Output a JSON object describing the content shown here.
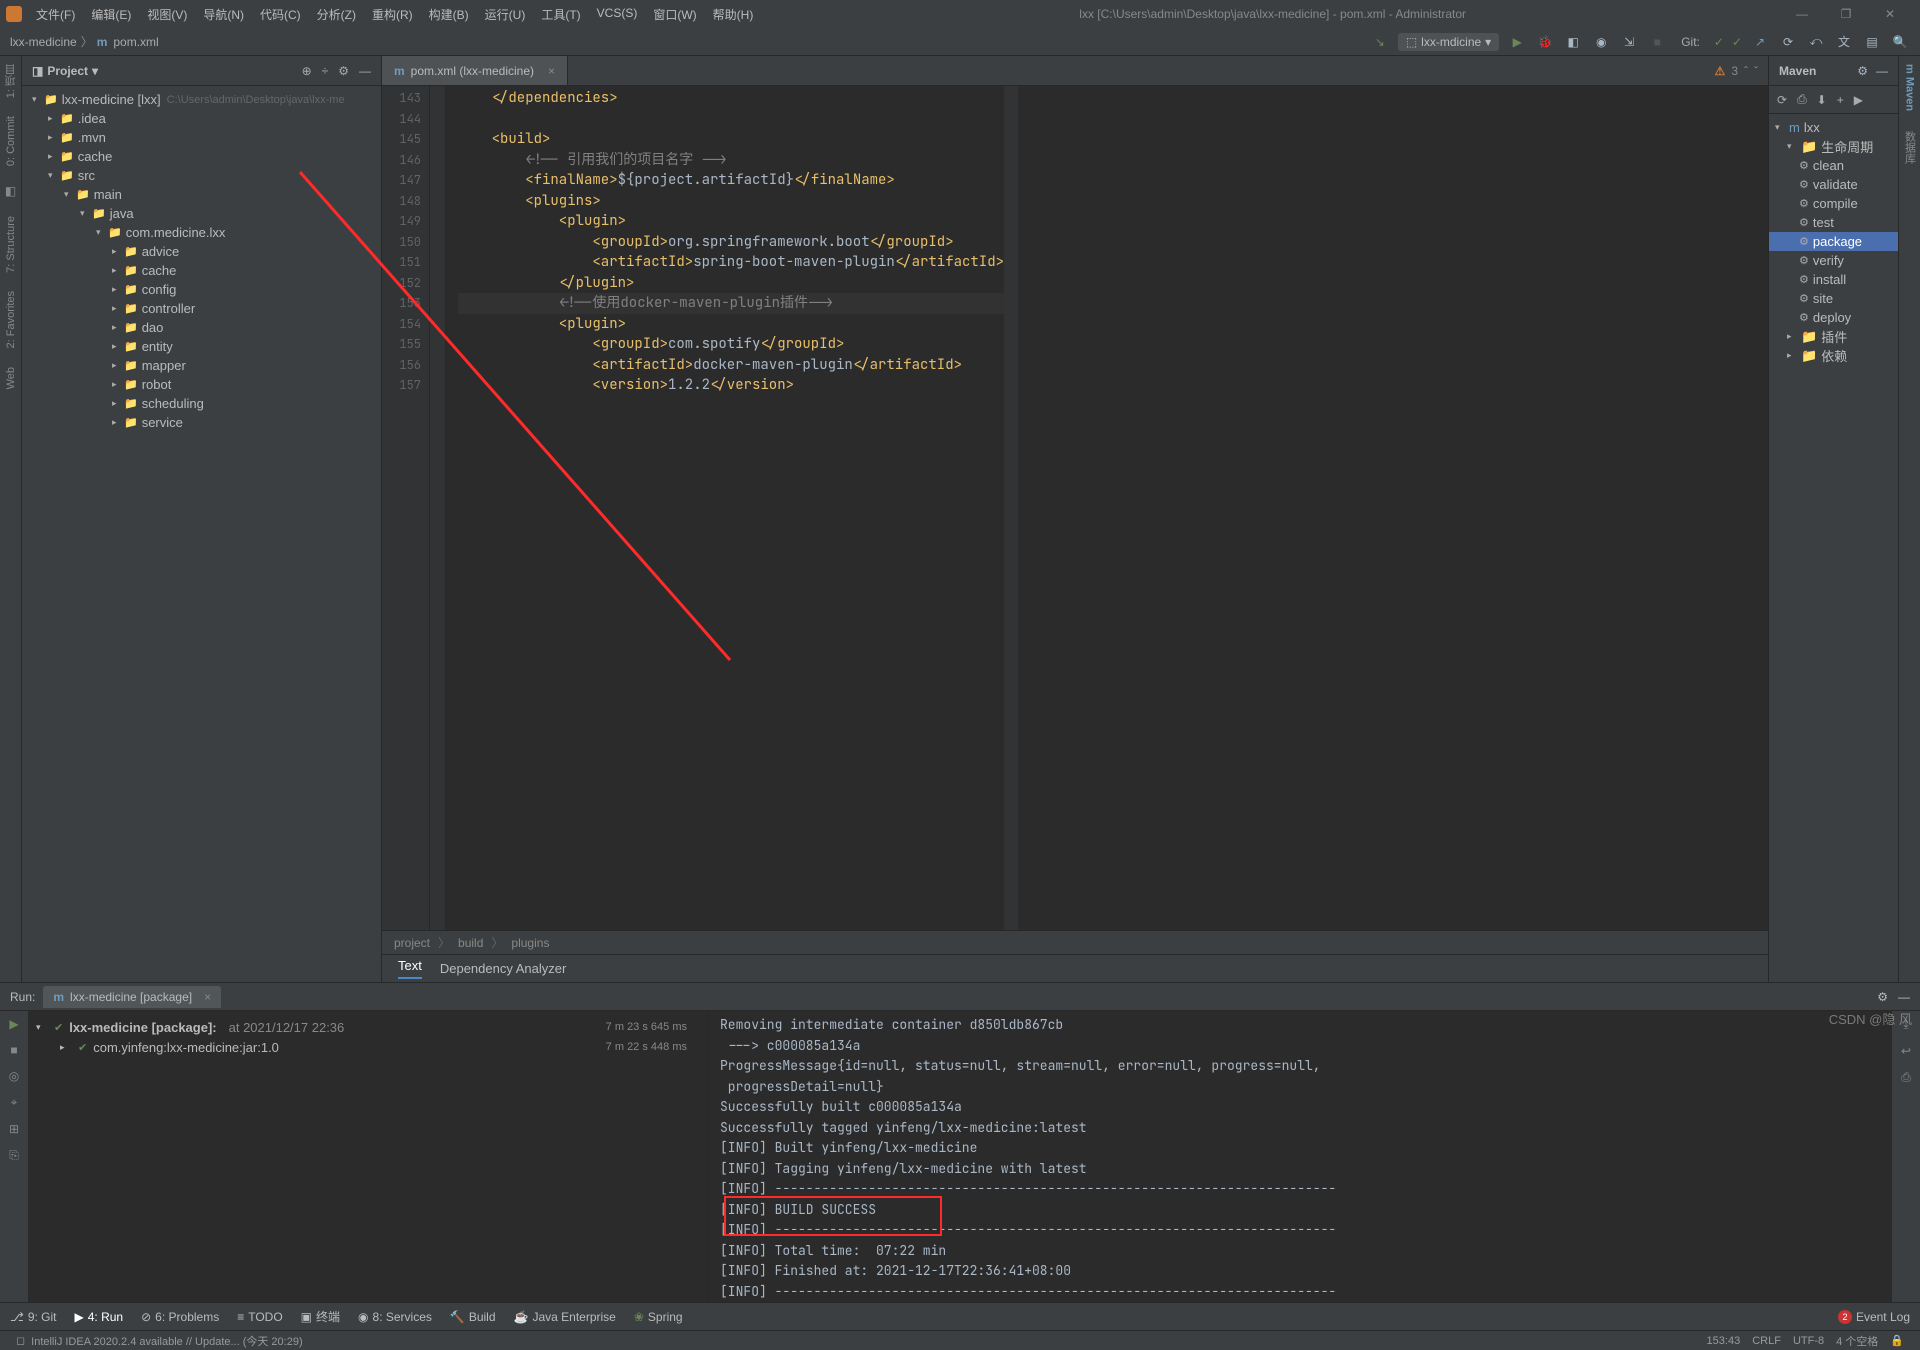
{
  "titlebar": {
    "menus": [
      "文件(F)",
      "编辑(E)",
      "视图(V)",
      "导航(N)",
      "代码(C)",
      "分析(Z)",
      "重构(R)",
      "构建(B)",
      "运行(U)",
      "工具(T)",
      "VCS(S)",
      "窗口(W)",
      "帮助(H)"
    ],
    "title": "lxx [C:\\Users\\admin\\Desktop\\java\\lxx-medicine] - pom.xml - Administrator"
  },
  "breadcrumb": {
    "items": [
      "lxx-medicine",
      "pom.xml"
    ]
  },
  "toolbar": {
    "run_config": "lxx-mdicine",
    "git_label": "Git:"
  },
  "left_tool_tabs": [
    "项目",
    "Commit",
    "Structure",
    "Favorites",
    "Web"
  ],
  "project": {
    "title": "Project",
    "root": {
      "name": "lxx-medicine [lxx]",
      "path": "C:\\Users\\admin\\Desktop\\java\\lxx-me"
    },
    "items": [
      ".idea",
      ".mvn",
      "cache",
      "src"
    ],
    "main": "main",
    "java": "java",
    "pkg": "com.medicine.lxx",
    "subpkgs": [
      "advice",
      "cache",
      "config",
      "controller",
      "dao",
      "entity",
      "mapper",
      "robot",
      "scheduling",
      "service"
    ]
  },
  "editor": {
    "tab": "pom.xml (lxx-medicine)",
    "inspection": {
      "warn_count": "3"
    },
    "lines": {
      "143": "</dependencies>",
      "144": "",
      "145": "<build>",
      "145b": "<!-- 引用我们的项目名字 -->",
      "147": "<finalName>${project.artifactId}</finalName>",
      "148": "<plugins>",
      "149": "<plugin>",
      "150": "<groupId>org.springframework.boot</groupId>",
      "151": "<artifactId>spring-boot-maven-plugin</artifactId>",
      "152": "</plugin>",
      "153": "<!--使用docker-maven-plugin插件-->",
      "154": "<plugin>",
      "155": "<groupId>com.spotify</groupId>",
      "156": "<artifactId>docker-maven-plugin</artifactId>",
      "157": "<version>1.2.2</version>"
    },
    "crumbs": [
      "project",
      "build",
      "plugins"
    ],
    "subtabs": [
      "Text",
      "Dependency Analyzer"
    ]
  },
  "maven": {
    "title": "Maven",
    "root": "lxx",
    "lifecycle": "生命周期",
    "phases": [
      "clean",
      "validate",
      "compile",
      "test",
      "package",
      "verify",
      "install",
      "site",
      "deploy"
    ],
    "plugins_label": "插件",
    "deps_label": "依赖"
  },
  "run": {
    "label": "Run:",
    "tab": "lxx-medicine [package]",
    "tree_root": {
      "name": "lxx-medicine [package]:",
      "ts": "at 2021/12/17 22:36",
      "elapsed": "7 m 23 s 645 ms"
    },
    "tree_child": {
      "name": "com.yinfeng:lxx-medicine:jar:1.0",
      "elapsed": "7 m 22 s 448 ms"
    },
    "console": [
      "Removing intermediate container d850ldb867cb",
      " ---> c000085a134a",
      "ProgressMessage{id=null, status=null, stream=null, error=null, progress=null,",
      " progressDetail=null}",
      "Successfully built c000085a134a",
      "Successfully tagged yinfeng/lxx-medicine:latest",
      "[INFO] Built yinfeng/lxx-medicine",
      "[INFO] Tagging yinfeng/lxx-medicine with latest",
      "[INFO] ------------------------------------------------------------------------",
      "[INFO] BUILD SUCCESS",
      "[INFO] ------------------------------------------------------------------------",
      "[INFO] Total time:  07:22 min",
      "[INFO] Finished at: 2021-12-17T22:36:41+08:00",
      "[INFO] ------------------------------------------------------------------------"
    ]
  },
  "bottombar": {
    "items": [
      "9: Git",
      "4: Run",
      "6: Problems",
      "TODO",
      "终端",
      "8: Services",
      "Build",
      "Java Enterprise",
      "Spring"
    ]
  },
  "status": {
    "hint": "IntelliJ IDEA 2020.2.4 available // Update... (今天 20:29)",
    "cursor": "153:43",
    "crlf": "CRLF",
    "enc": "UTF-8",
    "spaces": "4 个空格",
    "event_log": "Event Log",
    "event_count": "2"
  },
  "watermark": "CSDN @隐 风"
}
